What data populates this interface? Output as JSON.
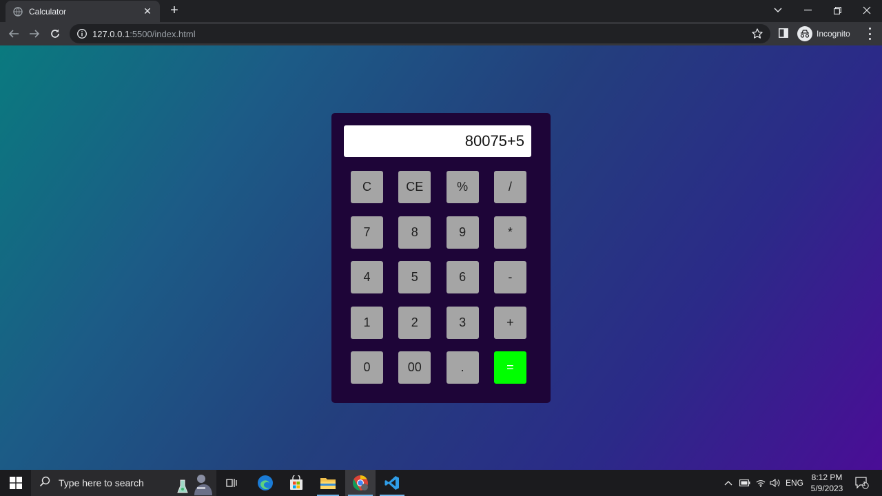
{
  "browser": {
    "tab_title": "Calculator",
    "new_tab_label": "+",
    "url_host": "127.0.0.1",
    "url_rest": ":5500/index.html",
    "profile_label": "Incognito"
  },
  "calculator": {
    "display_value": "80075+5",
    "keys": [
      {
        "label": "C",
        "row": 0,
        "col": 0
      },
      {
        "label": "CE",
        "row": 0,
        "col": 1
      },
      {
        "label": "%",
        "row": 0,
        "col": 2
      },
      {
        "label": "/",
        "row": 0,
        "col": 3
      },
      {
        "label": "7",
        "row": 1,
        "col": 0
      },
      {
        "label": "8",
        "row": 1,
        "col": 1
      },
      {
        "label": "9",
        "row": 1,
        "col": 2
      },
      {
        "label": "*",
        "row": 1,
        "col": 3
      },
      {
        "label": "4",
        "row": 2,
        "col": 0
      },
      {
        "label": "5",
        "row": 2,
        "col": 1
      },
      {
        "label": "6",
        "row": 2,
        "col": 2
      },
      {
        "label": "-",
        "row": 2,
        "col": 3
      },
      {
        "label": "1",
        "row": 3,
        "col": 0
      },
      {
        "label": "2",
        "row": 3,
        "col": 1
      },
      {
        "label": "3",
        "row": 3,
        "col": 2
      },
      {
        "label": "+",
        "row": 3,
        "col": 3
      },
      {
        "label": "0",
        "row": 4,
        "col": 0
      },
      {
        "label": "00",
        "row": 4,
        "col": 1
      },
      {
        "label": ".",
        "row": 4,
        "col": 2
      },
      {
        "label": "=",
        "row": 4,
        "col": 3,
        "accent": true
      }
    ],
    "colors": {
      "panel": "#1e0538",
      "key": "#a5a5a5",
      "equals": "#00ff00"
    }
  },
  "taskbar": {
    "search_placeholder": "Type here to search",
    "language": "ENG",
    "time": "8:12 PM",
    "date": "5/9/2023",
    "notification_count": "1"
  }
}
